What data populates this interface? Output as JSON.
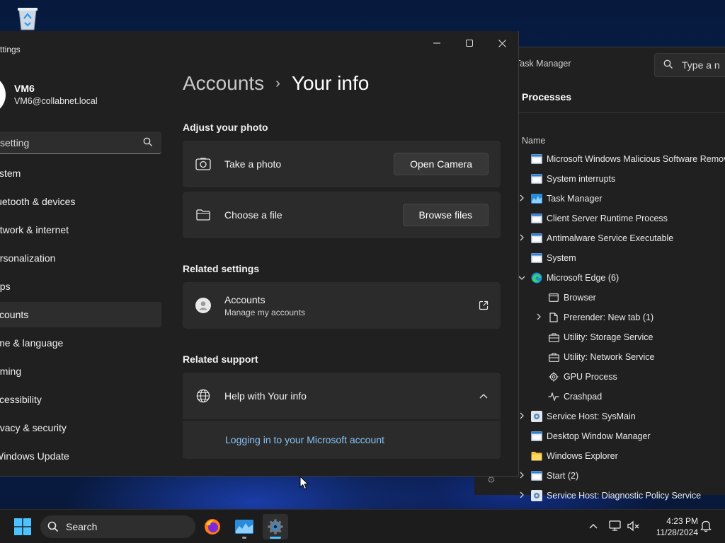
{
  "desktop": {
    "recycle_bin_icon": "recycle-bin-icon"
  },
  "task_manager": {
    "title": "Task Manager",
    "search_placeholder": "Type a n",
    "heading": "Processes",
    "column_name": "Name",
    "processes": [
      {
        "name": "Microsoft Windows Malicious Software Remov",
        "expand": false,
        "indent": 0,
        "icon": "window-app-icon"
      },
      {
        "name": "System interrupts",
        "expand": false,
        "indent": 0,
        "icon": "window-app-icon"
      },
      {
        "name": "Task Manager",
        "expand": true,
        "indent": 0,
        "icon": "task-manager-icon"
      },
      {
        "name": "Client Server Runtime Process",
        "expand": false,
        "indent": 0,
        "icon": "window-app-icon"
      },
      {
        "name": "Antimalware Service Executable",
        "expand": true,
        "indent": 0,
        "icon": "window-app-icon"
      },
      {
        "name": "System",
        "expand": false,
        "indent": 0,
        "icon": "window-app-icon"
      },
      {
        "name": "Microsoft Edge (6)",
        "expand": true,
        "expanded": true,
        "indent": 0,
        "icon": "edge-icon"
      },
      {
        "name": "Browser",
        "expand": false,
        "indent": 1,
        "icon": "browser-window-icon"
      },
      {
        "name": "Prerender: New tab (1)",
        "expand": true,
        "indent": 1,
        "icon": "document-icon"
      },
      {
        "name": "Utility: Storage Service",
        "expand": false,
        "indent": 1,
        "icon": "briefcase-icon"
      },
      {
        "name": "Utility: Network Service",
        "expand": false,
        "indent": 1,
        "icon": "briefcase-icon"
      },
      {
        "name": "GPU Process",
        "expand": false,
        "indent": 1,
        "icon": "gear-icon"
      },
      {
        "name": "Crashpad",
        "expand": false,
        "indent": 1,
        "icon": "pulse-icon"
      },
      {
        "name": "Service Host: SysMain",
        "expand": true,
        "indent": 0,
        "icon": "service-gear-icon"
      },
      {
        "name": "Desktop Window Manager",
        "expand": false,
        "indent": 0,
        "icon": "window-app-icon"
      },
      {
        "name": "Windows Explorer",
        "expand": false,
        "indent": 0,
        "icon": "folder-icon"
      },
      {
        "name": "Start (2)",
        "expand": true,
        "indent": 0,
        "icon": "window-app-icon"
      },
      {
        "name": "Service Host: Diagnostic Policy Service",
        "expand": true,
        "indent": 0,
        "icon": "service-gear-icon"
      }
    ]
  },
  "settings": {
    "window_title": "ttings",
    "profile": {
      "name": "VM6",
      "email": "VM6@collabnet.local"
    },
    "search_placeholder": "setting",
    "nav": [
      {
        "label": "ystem",
        "active": false
      },
      {
        "label": "luetooth & devices",
        "active": false
      },
      {
        "label": "etwork & internet",
        "active": false
      },
      {
        "label": "ersonalization",
        "active": false
      },
      {
        "label": "pps",
        "active": false
      },
      {
        "label": "ccounts",
        "active": true
      },
      {
        "label": "ime & language",
        "active": false
      },
      {
        "label": "aming",
        "active": false
      },
      {
        "label": "ccessibility",
        "active": false
      },
      {
        "label": "rivacy & security",
        "active": false
      },
      {
        "label": "Windows Update",
        "active": false
      }
    ],
    "breadcrumb": {
      "parent": "Accounts",
      "separator": "›",
      "current": "Your info"
    },
    "adjust_photo": {
      "heading": "Adjust your photo",
      "take_photo_label": "Take a photo",
      "open_camera_label": "Open Camera",
      "choose_file_label": "Choose a file",
      "browse_files_label": "Browse files"
    },
    "related_settings": {
      "heading": "Related settings",
      "accounts_label": "Accounts",
      "accounts_sub": "Manage my accounts"
    },
    "related_support": {
      "heading": "Related support",
      "help_label": "Help with Your info",
      "link": "Logging in to your Microsoft account"
    }
  },
  "taskbar": {
    "search_label": "Search",
    "time": "4:23 PM",
    "date": "11/28/2024",
    "accent": "#4cc2ff"
  }
}
